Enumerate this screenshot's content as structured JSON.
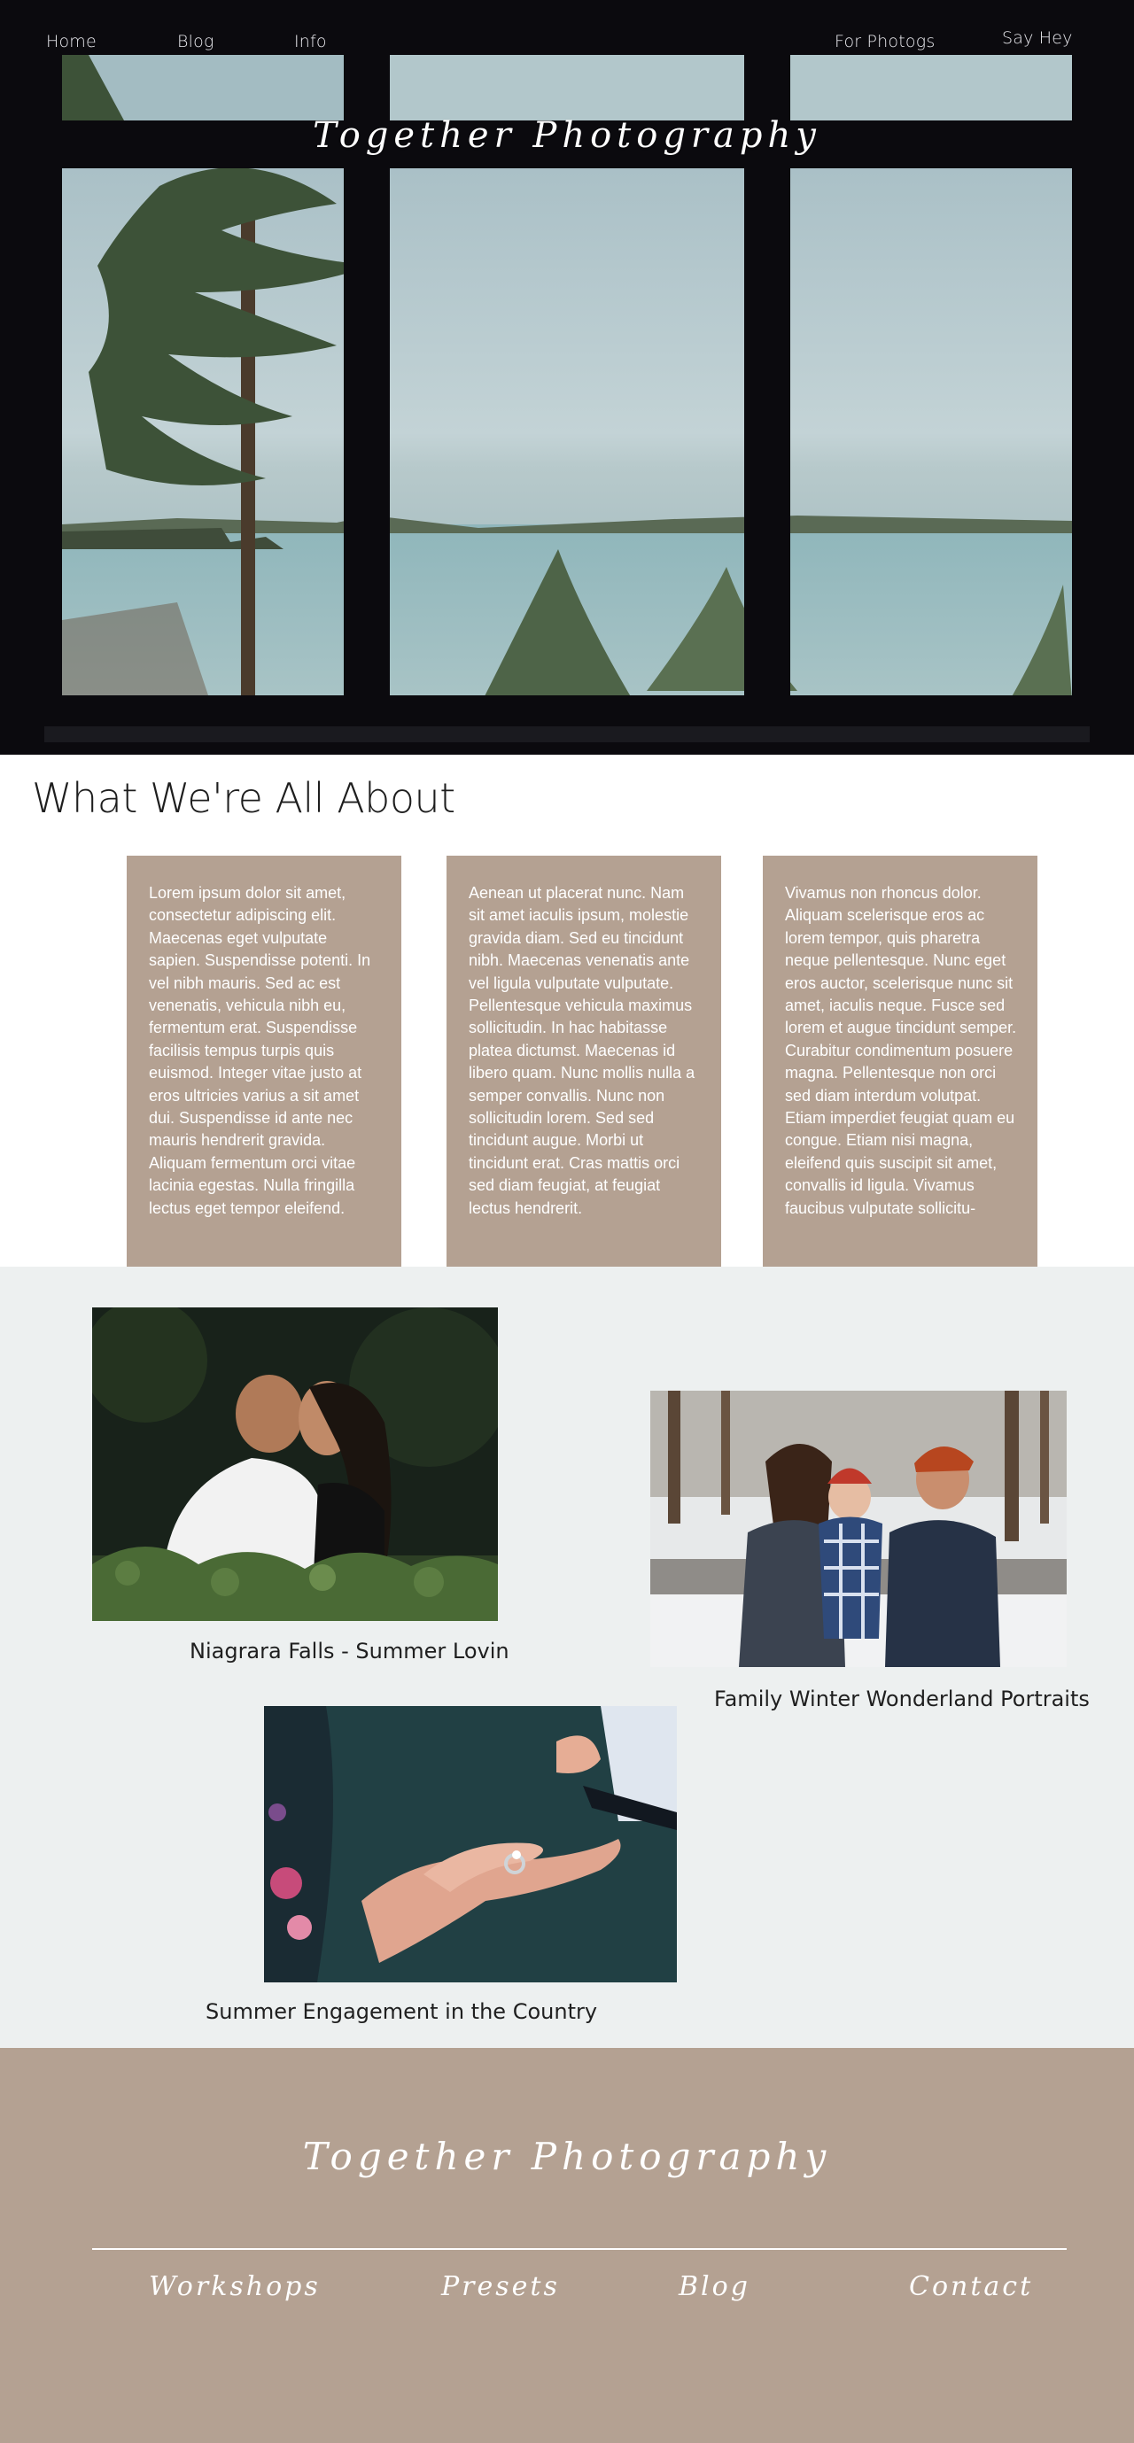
{
  "nav": {
    "home": "Home",
    "blog": "Blog",
    "info": "Info",
    "for_photogs": "For Photogs",
    "say_hey": "Say Hey"
  },
  "brand": "Together Photography",
  "about": {
    "heading": "What We're All About",
    "cards": [
      "Lorem ipsum dolor sit amet, consectetur adipiscing elit. Maecenas eget vulputate sapien. Suspendisse potenti. In vel nibh mauris. Sed ac est venenatis, vehicula nibh eu, fermentum erat. Suspendisse facilisis tempus turpis quis euismod. Integer vitae justo at eros ultricies varius a sit amet dui. Suspendisse id ante nec mauris hendrerit gravida. Aliquam fermentum orci vitae lacinia egestas. Nulla fringilla lectus eget tempor eleifend.",
      "Aenean ut placerat nunc. Nam sit amet iaculis ipsum, molestie gravida diam. Sed eu tincidunt nibh. Maecenas venenatis ante vel ligula vulputate vulputate. Pellentesque vehicula maximus sollicitudin. In hac habitasse platea dictumst. Maecenas id libero quam. Nunc mollis nulla a semper convallis. Nunc non sollicitudin lorem. Sed sed tincidunt augue. Morbi ut tincidunt erat. Cras mattis orci sed diam feugiat, at feugiat lectus hendrerit.",
      "Vivamus non rhoncus dolor. Aliquam scelerisque eros ac lorem tempor, quis pharetra neque pellentesque. Nunc eget eros auctor, scelerisque nunc sit amet, iaculis neque. Fusce sed lorem et augue tincidunt semper. Curabitur condimentum posuere magna. Pellentesque non orci sed diam interdum volutpat. Etiam imperdiet feugiat quam eu congue. Etiam nisi magna, eleifend quis suscipit sit amet, convallis id ligula. Vivamus faucibus vulputate sollicitu-"
    ]
  },
  "gallery": {
    "items": [
      {
        "caption": "Niagrara Falls - Summer Lovin"
      },
      {
        "caption": "Family Winter Wonderland Portraits"
      },
      {
        "caption": "Summer Engagement in the Country"
      }
    ]
  },
  "footer": {
    "brand": "Together Photography",
    "links": [
      "Workshops",
      "Presets",
      "Blog",
      "Contact"
    ]
  },
  "colors": {
    "accent_taupe": "#b4a192",
    "gallery_bg": "#edf0f0",
    "hero_frame": "#0b0a0e"
  }
}
